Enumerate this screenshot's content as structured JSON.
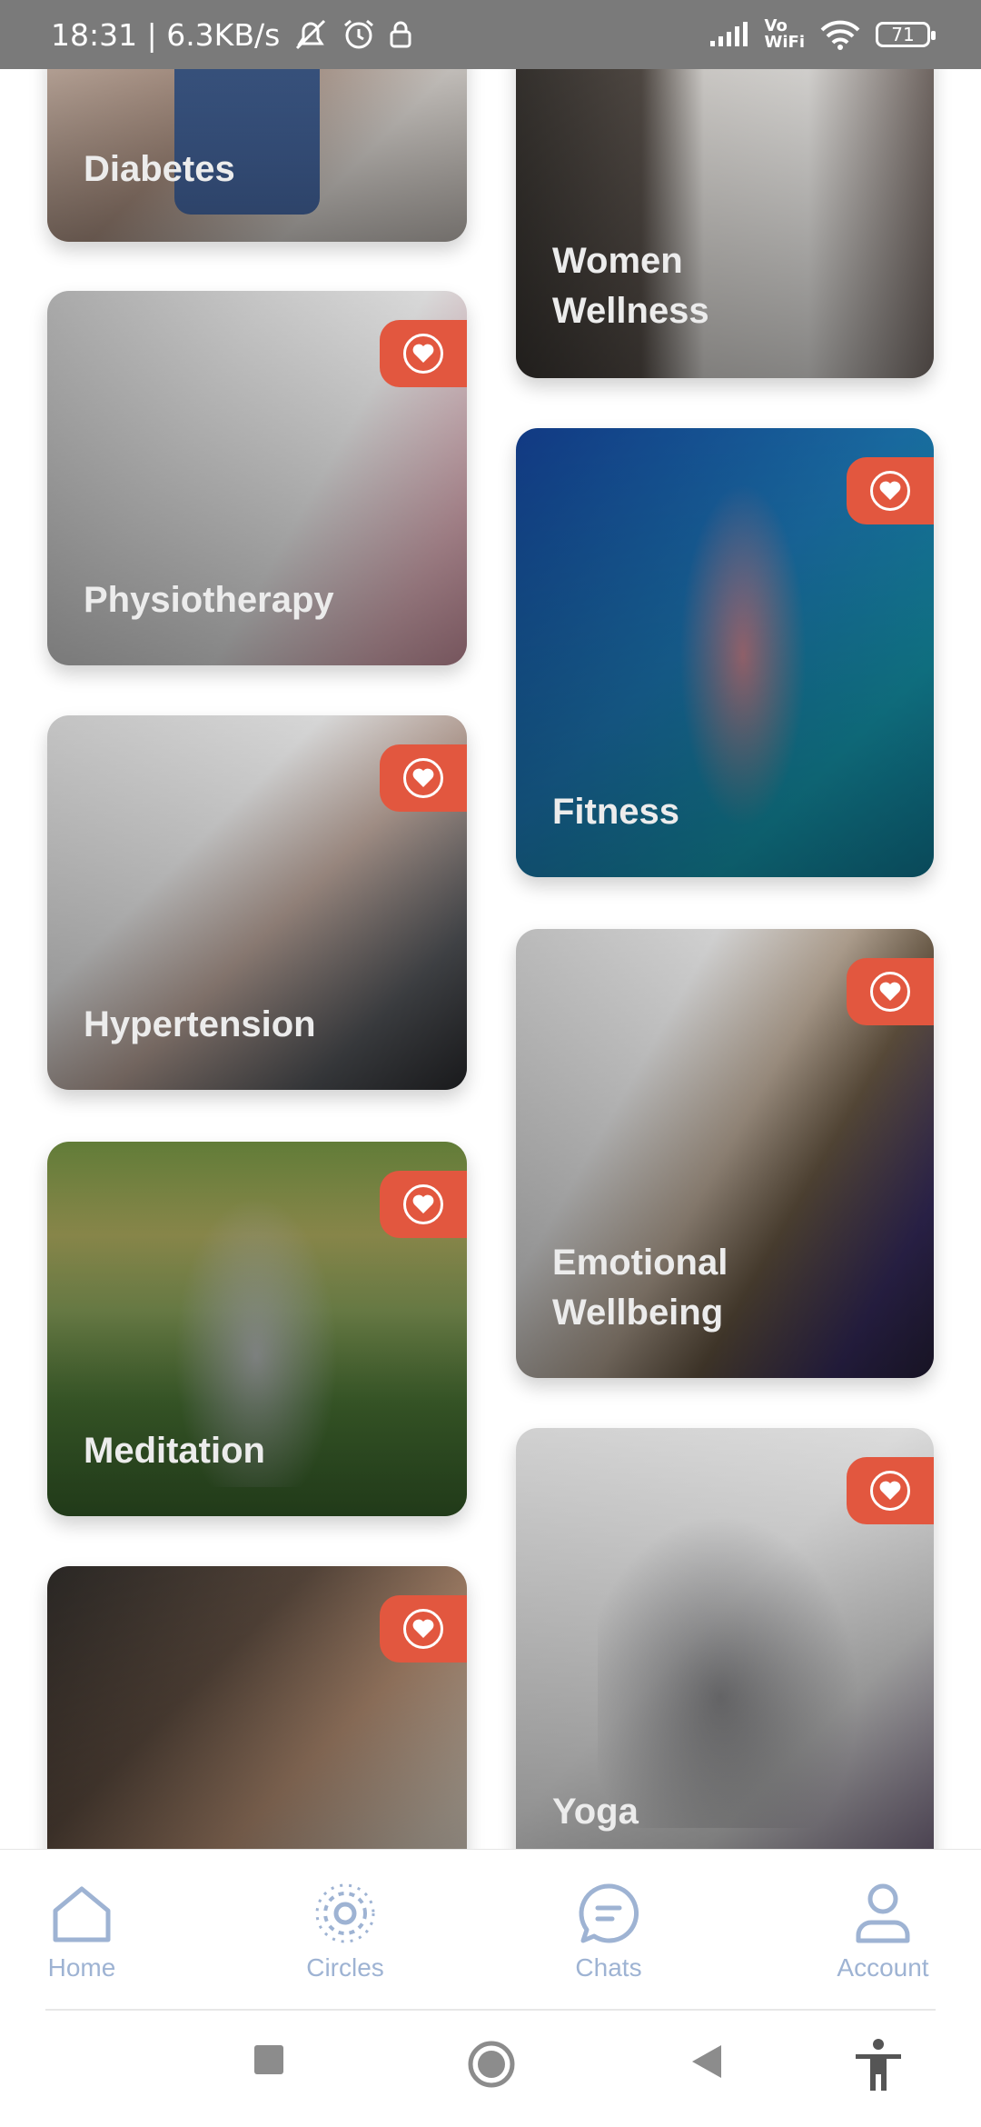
{
  "status_bar": {
    "time_speed": "18:31 | 6.3KB/s",
    "network_label": "Vo\nWiFi",
    "battery": "71"
  },
  "cards": [
    {
      "label": "Diabetes",
      "favorite": false
    },
    {
      "label": "Women\nWellness",
      "favorite": false
    },
    {
      "label": "Physiotherapy",
      "favorite": true
    },
    {
      "label": "Fitness",
      "favorite": true
    },
    {
      "label": "Hypertension",
      "favorite": true
    },
    {
      "label": "Emotional\nWellbeing",
      "favorite": true
    },
    {
      "label": "Meditation",
      "favorite": true
    },
    {
      "label": "",
      "favorite": true
    },
    {
      "label": "Yoga",
      "favorite": true
    }
  ],
  "bottom_nav": {
    "items": [
      {
        "label": "Home",
        "icon": "home-icon"
      },
      {
        "label": "Circles",
        "icon": "circles-icon"
      },
      {
        "label": "Chats",
        "icon": "chat-icon"
      },
      {
        "label": "Account",
        "icon": "account-icon"
      }
    ]
  },
  "colors": {
    "accent": "#e2573f",
    "nav_icon": "#9eb3d3",
    "status_bar": "#7a7a7a"
  }
}
